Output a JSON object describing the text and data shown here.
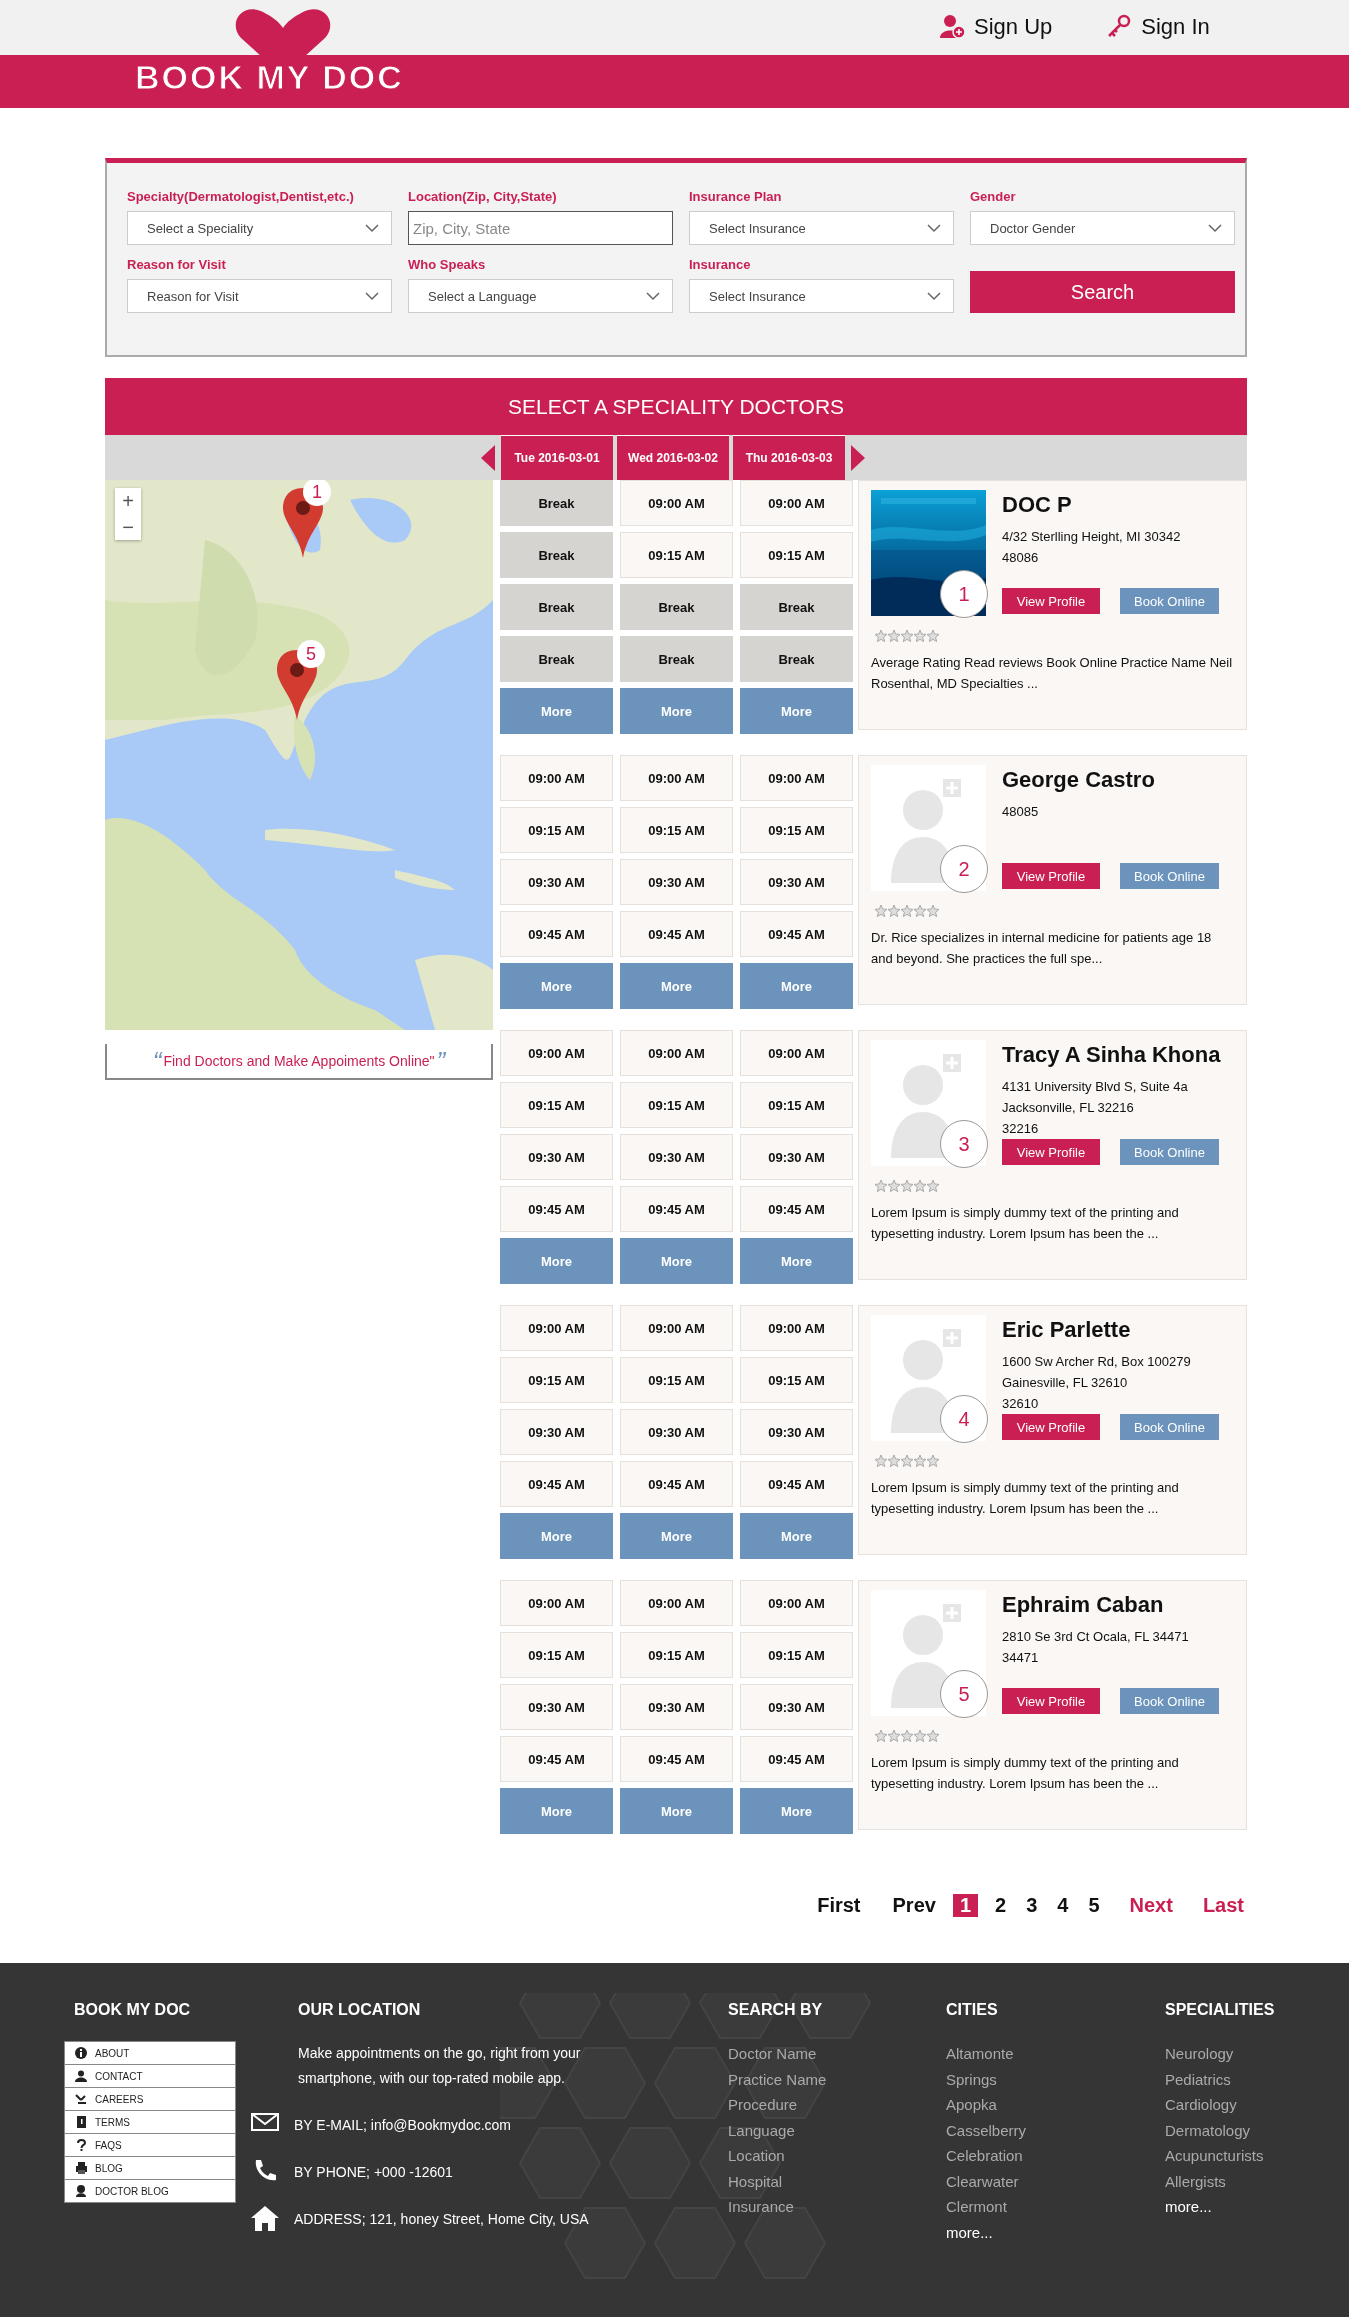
{
  "header": {
    "logo": "BOOK MY DOC",
    "links": [
      {
        "label": "Sign Up"
      },
      {
        "label": "Sign In"
      }
    ]
  },
  "search": {
    "fields": [
      {
        "label": "Specialty(Dermatologist,Dentist,etc.)",
        "kind": "select",
        "value": "Select a Speciality"
      },
      {
        "label": "Location(Zip, City,State)",
        "kind": "text",
        "placeholder": "Zip, City, State"
      },
      {
        "label": "Insurance Plan",
        "kind": "select",
        "value": "Select Insurance"
      },
      {
        "label": "Gender",
        "kind": "select",
        "value": "Doctor Gender"
      },
      {
        "label": "Reason for Visit",
        "kind": "select",
        "value": "Reason for Visit"
      },
      {
        "label": "Who Speaks",
        "kind": "select",
        "value": "Select a Language"
      },
      {
        "label": "Insurance",
        "kind": "select",
        "value": "Select Insurance"
      }
    ],
    "button": "Search"
  },
  "results": {
    "title": "SELECT A SPECIALITY DOCTORS",
    "dates": [
      "Tue 2016-03-01",
      "Wed 2016-03-02",
      "Thu 2016-03-03"
    ],
    "map": {
      "zoom_in": "+",
      "zoom_out": "−",
      "markers": [
        "1",
        "5"
      ]
    },
    "tagline": {
      "open": "“",
      "text": "Find Doctors and Make Appoiments Online\"",
      "close": "”"
    },
    "doctors": [
      {
        "name": "DOC P",
        "address": [
          "4/32 Sterlling Height, MI 30342",
          "48086"
        ],
        "number": "1",
        "stars": 0,
        "view": "View Profile",
        "book": "Book Online",
        "description": "Average Rating Read reviews Book Online Practice Name Neil Rosenthal, MD Specialties ...",
        "slots": [
          [
            {
              "text": "Break",
              "kind": "break"
            },
            {
              "text": "09:00 AM",
              "kind": "time"
            },
            {
              "text": "09:00 AM",
              "kind": "time"
            }
          ],
          [
            {
              "text": "Break",
              "kind": "break"
            },
            {
              "text": "09:15 AM",
              "kind": "time"
            },
            {
              "text": "09:15 AM",
              "kind": "time"
            }
          ],
          [
            {
              "text": "Break",
              "kind": "break"
            },
            {
              "text": "Break",
              "kind": "break"
            },
            {
              "text": "Break",
              "kind": "break"
            }
          ],
          [
            {
              "text": "Break",
              "kind": "break"
            },
            {
              "text": "Break",
              "kind": "break"
            },
            {
              "text": "Break",
              "kind": "break"
            }
          ]
        ],
        "more": [
          "More",
          "More",
          "More"
        ]
      },
      {
        "name": "George Castro",
        "address": [
          "48085"
        ],
        "number": "2",
        "stars": 0,
        "view": "View Profile",
        "book": "Book Online",
        "description": "Dr. Rice specializes in internal medicine for patients age 18 and beyond. She practices the full spe...",
        "slots": [
          [
            {
              "text": "09:00 AM",
              "kind": "time"
            },
            {
              "text": "09:00 AM",
              "kind": "time"
            },
            {
              "text": "09:00 AM",
              "kind": "time"
            }
          ],
          [
            {
              "text": "09:15 AM",
              "kind": "time"
            },
            {
              "text": "09:15 AM",
              "kind": "time"
            },
            {
              "text": "09:15 AM",
              "kind": "time"
            }
          ],
          [
            {
              "text": "09:30 AM",
              "kind": "time"
            },
            {
              "text": "09:30 AM",
              "kind": "time"
            },
            {
              "text": "09:30 AM",
              "kind": "time"
            }
          ],
          [
            {
              "text": "09:45 AM",
              "kind": "time"
            },
            {
              "text": "09:45 AM",
              "kind": "time"
            },
            {
              "text": "09:45 AM",
              "kind": "time"
            }
          ]
        ],
        "more": [
          "More",
          "More",
          "More"
        ]
      },
      {
        "name": "Tracy A Sinha Khona",
        "address": [
          "4131 University Blvd S, Suite 4a",
          "Jacksonville, FL 32216",
          "32216"
        ],
        "number": "3",
        "stars": 0,
        "view": "View Profile",
        "book": "Book Online",
        "description": "Lorem Ipsum is simply dummy text of the printing and typesetting industry. Lorem Ipsum has been the ...",
        "slots": [
          [
            {
              "text": "09:00 AM",
              "kind": "time"
            },
            {
              "text": "09:00 AM",
              "kind": "time"
            },
            {
              "text": "09:00 AM",
              "kind": "time"
            }
          ],
          [
            {
              "text": "09:15 AM",
              "kind": "time"
            },
            {
              "text": "09:15 AM",
              "kind": "time"
            },
            {
              "text": "09:15 AM",
              "kind": "time"
            }
          ],
          [
            {
              "text": "09:30 AM",
              "kind": "time"
            },
            {
              "text": "09:30 AM",
              "kind": "time"
            },
            {
              "text": "09:30 AM",
              "kind": "time"
            }
          ],
          [
            {
              "text": "09:45 AM",
              "kind": "time"
            },
            {
              "text": "09:45 AM",
              "kind": "time"
            },
            {
              "text": "09:45 AM",
              "kind": "time"
            }
          ]
        ],
        "more": [
          "More",
          "More",
          "More"
        ]
      },
      {
        "name": "Eric Parlette",
        "address": [
          "1600 Sw Archer Rd, Box 100279",
          "Gainesville, FL 32610",
          "32610"
        ],
        "number": "4",
        "stars": 0,
        "view": "View Profile",
        "book": "Book Online",
        "description": "Lorem Ipsum is simply dummy text of the printing and typesetting industry. Lorem Ipsum has been the ...",
        "slots": [
          [
            {
              "text": "09:00 AM",
              "kind": "time"
            },
            {
              "text": "09:00 AM",
              "kind": "time"
            },
            {
              "text": "09:00 AM",
              "kind": "time"
            }
          ],
          [
            {
              "text": "09:15 AM",
              "kind": "time"
            },
            {
              "text": "09:15 AM",
              "kind": "time"
            },
            {
              "text": "09:15 AM",
              "kind": "time"
            }
          ],
          [
            {
              "text": "09:30 AM",
              "kind": "time"
            },
            {
              "text": "09:30 AM",
              "kind": "time"
            },
            {
              "text": "09:30 AM",
              "kind": "time"
            }
          ],
          [
            {
              "text": "09:45 AM",
              "kind": "time"
            },
            {
              "text": "09:45 AM",
              "kind": "time"
            },
            {
              "text": "09:45 AM",
              "kind": "time"
            }
          ]
        ],
        "more": [
          "More",
          "More",
          "More"
        ]
      },
      {
        "name": "Ephraim Caban",
        "address": [
          "2810 Se 3rd Ct Ocala, FL 34471",
          "34471"
        ],
        "number": "5",
        "stars": 0,
        "view": "View Profile",
        "book": "Book Online",
        "description": "Lorem Ipsum is simply dummy text of the printing and typesetting industry. Lorem Ipsum has been the ...",
        "slots": [
          [
            {
              "text": "09:00 AM",
              "kind": "time"
            },
            {
              "text": "09:00 AM",
              "kind": "time"
            },
            {
              "text": "09:00 AM",
              "kind": "time"
            }
          ],
          [
            {
              "text": "09:15 AM",
              "kind": "time"
            },
            {
              "text": "09:15 AM",
              "kind": "time"
            },
            {
              "text": "09:15 AM",
              "kind": "time"
            }
          ],
          [
            {
              "text": "09:30 AM",
              "kind": "time"
            },
            {
              "text": "09:30 AM",
              "kind": "time"
            },
            {
              "text": "09:30 AM",
              "kind": "time"
            }
          ],
          [
            {
              "text": "09:45 AM",
              "kind": "time"
            },
            {
              "text": "09:45 AM",
              "kind": "time"
            },
            {
              "text": "09:45 AM",
              "kind": "time"
            }
          ]
        ],
        "more": [
          "More",
          "More",
          "More"
        ]
      }
    ]
  },
  "pagination": {
    "items": [
      {
        "label": "First",
        "kind": "nav",
        "selected": false
      },
      {
        "label": "Prev",
        "kind": "nav",
        "selected": false
      },
      {
        "label": "1",
        "kind": "page",
        "selected": true
      },
      {
        "label": "2",
        "kind": "page",
        "selected": false
      },
      {
        "label": "3",
        "kind": "page",
        "selected": false
      },
      {
        "label": "4",
        "kind": "page",
        "selected": false
      },
      {
        "label": "5",
        "kind": "page",
        "selected": false
      },
      {
        "label": "Next",
        "kind": "accent",
        "selected": false
      },
      {
        "label": "Last",
        "kind": "accent",
        "selected": false
      }
    ]
  },
  "footer": {
    "brand": {
      "title": "BOOK MY DOC",
      "menu": [
        "ABOUT",
        "CONTACT",
        "CAREERS",
        "TERMS",
        "FAQS",
        "BLOG",
        "DOCTOR BLOG"
      ]
    },
    "location": {
      "title": "OUR LOCATION",
      "text": "Make appointments on the go, right from your smartphone, with our top-rated mobile app.",
      "contacts": [
        "BY E-MAIL; info@Bookmydoc.com",
        "BY PHONE; +000 -12601",
        "ADDRESS; 121, honey Street, Home City, USA"
      ]
    },
    "lists": [
      {
        "title": "SEARCH BY",
        "items": [
          "Doctor Name",
          "Practice Name",
          "Procedure",
          "Language",
          "Location",
          "Hospital",
          "Insurance"
        ]
      },
      {
        "title": "CITIES",
        "items": [
          "Altamonte",
          "Springs",
          "Apopka",
          "Casselberry",
          "Celebration",
          "Clearwater",
          "Clermont"
        ],
        "more": "more..."
      },
      {
        "title": "SPECIALITIES",
        "items": [
          "Neurology",
          "Pediatrics",
          "Cardiology",
          "Dermatology",
          "Acupuncturists",
          "Allergists"
        ],
        "more": "more..."
      }
    ]
  }
}
